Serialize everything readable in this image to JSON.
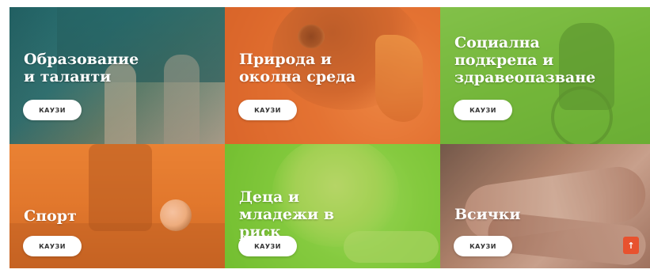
{
  "categories": [
    {
      "title": "Образование и таланти",
      "button": "КАУЗИ"
    },
    {
      "title": "Природа и околна среда",
      "button": "КАУЗИ"
    },
    {
      "title": "Социална подкрепа и здравеопазване",
      "button": "КАУЗИ"
    },
    {
      "title": "Спорт",
      "button": "КАУЗИ"
    },
    {
      "title": "Деца и младежи в риск",
      "button": "КАУЗИ"
    },
    {
      "title": "Всички",
      "button": "КАУЗИ"
    }
  ],
  "scroll_top": {
    "icon": "arrow-up-icon",
    "glyph": "↑"
  },
  "colors": {
    "orange_tint": "#e86e2d",
    "green_tint": "#78be3c",
    "scroll_button": "#e8522e"
  }
}
